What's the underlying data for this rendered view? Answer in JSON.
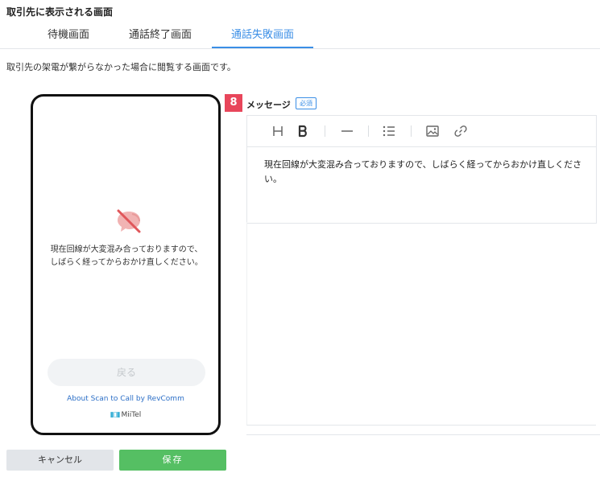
{
  "section_title": "取引先に表示される画面",
  "tabs": [
    {
      "label": "待機画面",
      "active": false
    },
    {
      "label": "通話終了画面",
      "active": false
    },
    {
      "label": "通話失敗画面",
      "active": true
    }
  ],
  "description": "取引先の架電が繋がらなかった場合に閲覧する画面です。",
  "phone": {
    "icon": "speech-bubble-slash-icon",
    "message_line1": "現在回線が大変混み合っておりますので、",
    "message_line2": "しばらく経ってからおかけ直しください。",
    "back_button": "戻る",
    "about_link": "About Scan to Call by RevComm",
    "brand": "MiiTel"
  },
  "editor": {
    "badge": "8",
    "label": "メッセージ",
    "required": "必須",
    "toolbar": [
      "heading-icon",
      "bold-icon",
      "horizontal-rule-icon",
      "list-icon",
      "image-icon",
      "link-icon"
    ],
    "content": "現在回線が大変混み合っておりますので、しばらく経ってからおかけ直しください。"
  },
  "buttons": {
    "cancel": "キャンセル",
    "save": "保存"
  },
  "colors": {
    "accent": "#3a8ee6",
    "badge": "#e8465b",
    "save": "#55bf63",
    "icon_muted": "#e8a3a3"
  }
}
